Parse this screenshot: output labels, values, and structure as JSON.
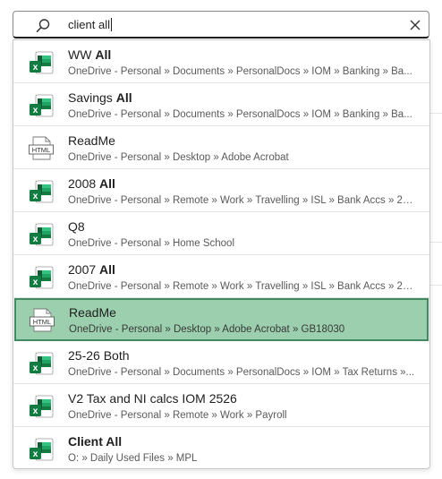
{
  "search": {
    "query": "client all"
  },
  "results": [
    {
      "icon": "excel-file-icon",
      "title_plain": "WW ",
      "title_bold": "All",
      "path": "OneDrive - Personal » Documents » PersonalDocs » IOM » Banking » Ba...",
      "selected": false
    },
    {
      "icon": "excel-file-icon",
      "title_plain": "Savings ",
      "title_bold": "All",
      "path": "OneDrive - Personal » Documents » PersonalDocs » IOM » Banking » Ba...",
      "selected": false
    },
    {
      "icon": "html-file-icon",
      "icon_label": "HTML",
      "title_plain": "ReadMe",
      "title_bold": "",
      "path": "OneDrive - Personal » Desktop » Adobe Acrobat",
      "selected": false
    },
    {
      "icon": "excel-file-icon",
      "title_plain": "2008 ",
      "title_bold": "All",
      "path": "OneDrive - Personal » Remote » Work » Travelling » ISL » Bank Accs » 20...",
      "selected": false
    },
    {
      "icon": "excel-file-icon",
      "title_plain": "Q8",
      "title_bold": "",
      "path": "OneDrive - Personal » Home School",
      "selected": false
    },
    {
      "icon": "excel-file-icon",
      "title_plain": "2007 ",
      "title_bold": "All",
      "path": "OneDrive - Personal » Remote » Work » Travelling » ISL » Bank Accs » 20...",
      "selected": false
    },
    {
      "icon": "html-file-icon",
      "icon_label": "HTML",
      "title_plain": "ReadMe",
      "title_bold": "",
      "path": "OneDrive - Personal » Desktop » Adobe Acrobat » GB18030",
      "selected": true
    },
    {
      "icon": "excel-file-icon",
      "title_plain": "25-26 Both",
      "title_bold": "",
      "path": "OneDrive - Personal » Documents » PersonalDocs » IOM » Tax Returns »...",
      "selected": false
    },
    {
      "icon": "excel-file-icon",
      "title_plain": "V2 Tax and NI calcs IOM 2526",
      "title_bold": "",
      "path": "OneDrive - Personal » Remote » Work » Payroll",
      "selected": false
    },
    {
      "icon": "excel-file-icon",
      "title_plain": "",
      "title_bold": "Client All",
      "path": "O: » Daily Used Files » MPL",
      "selected": false
    }
  ],
  "colors": {
    "excel_dark": "#1d6f42",
    "excel_mid": "#21a366",
    "excel_light": "#33c481",
    "selected_bg": "#9bcfae",
    "selected_border": "#3f8a5e"
  }
}
